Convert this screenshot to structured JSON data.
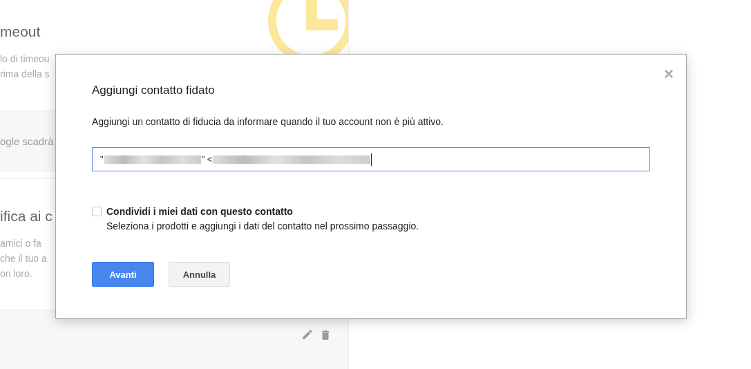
{
  "background": {
    "sections": [
      {
        "heading": "meout",
        "lines": [
          "lo di timeou",
          "rima della s"
        ],
        "note": "ogle scadrà"
      },
      {
        "heading": "ifica ai c",
        "lines": [
          "amici o fa",
          "che il tuo a",
          "on loro."
        ],
        "actions": true
      }
    ]
  },
  "dialog": {
    "title": "Aggiungi contatto fidato",
    "close": "×",
    "description": "Aggiungi un contatto di fiducia da informare quando il tuo account non è più attivo.",
    "field": {
      "visible_text": [
        "\"",
        "\" <"
      ],
      "focused": true
    },
    "share": {
      "label": "Condividi i miei dati con questo contatto",
      "hint": "Seleziona i prodotti e aggiungi i dati del contatto nel prossimo passaggio.",
      "checked": false
    },
    "buttons": [
      {
        "label": "Avanti",
        "kind": "primary"
      },
      {
        "label": "Annulla",
        "kind": "secondary"
      }
    ]
  }
}
